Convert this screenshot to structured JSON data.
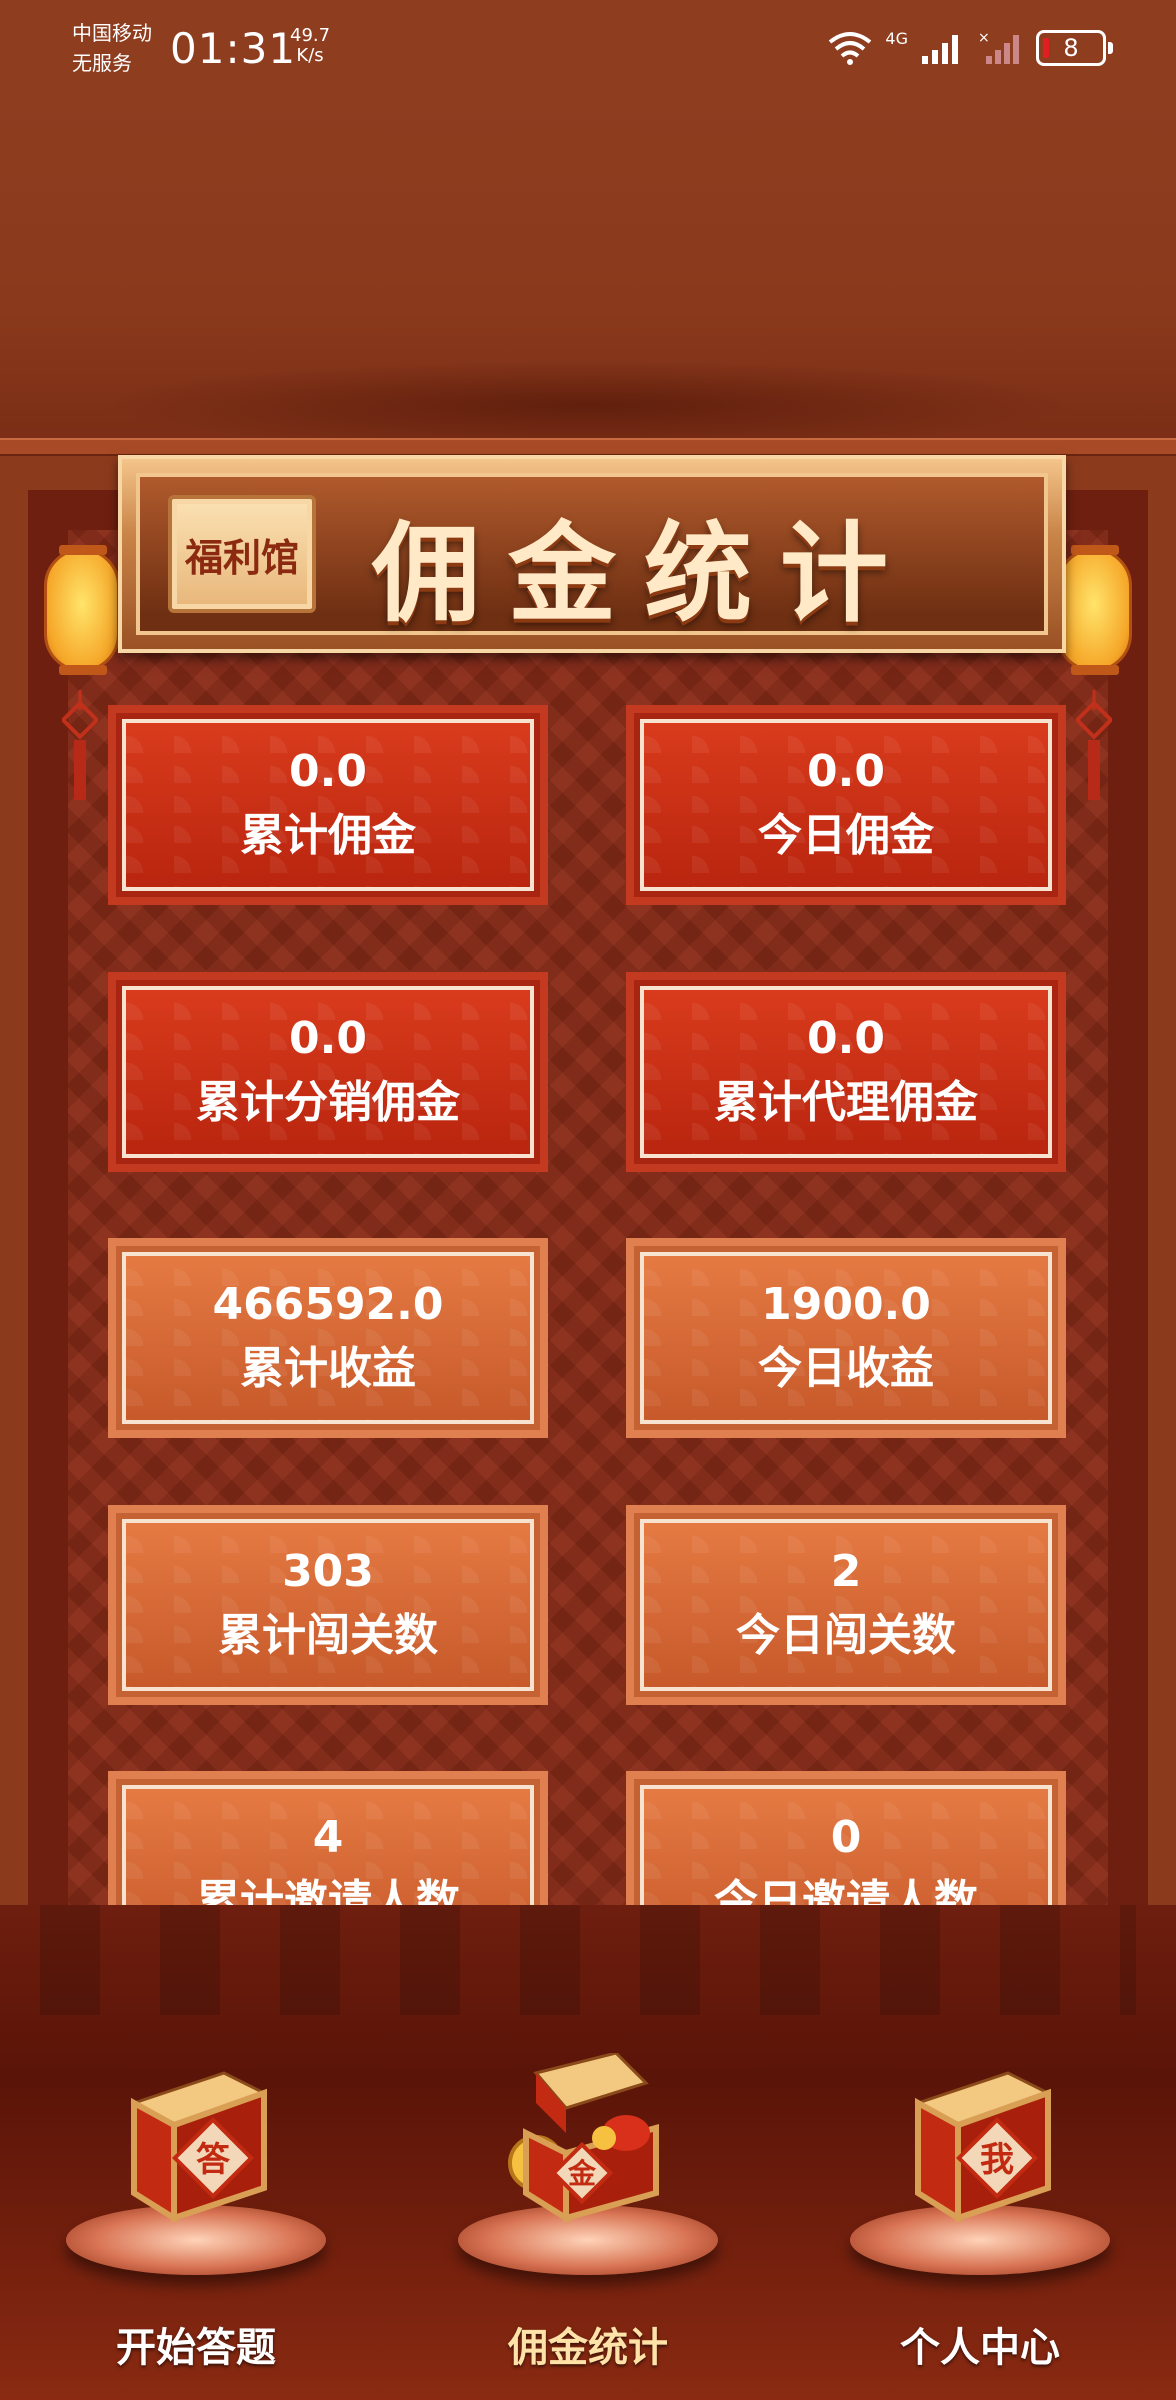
{
  "status_bar": {
    "carrier_line1": "中国移动",
    "carrier_line2": "无服务",
    "time": "01:31",
    "speed_value": "49.7",
    "speed_unit": "K/s",
    "network_label": "4G",
    "battery": "8"
  },
  "header": {
    "badge": "福利馆",
    "title": "佣金统计"
  },
  "stats": [
    {
      "value": "0.0",
      "label": "累计佣金",
      "style": "red"
    },
    {
      "value": "0.0",
      "label": "今日佣金",
      "style": "red"
    },
    {
      "value": "0.0",
      "label": "累计分销佣金",
      "style": "red"
    },
    {
      "value": "0.0",
      "label": "累计代理佣金",
      "style": "red"
    },
    {
      "value": "466592.0",
      "label": "累计收益",
      "style": "orange"
    },
    {
      "value": "1900.0",
      "label": "今日收益",
      "style": "orange"
    },
    {
      "value": "303",
      "label": "累计闯关数",
      "style": "orange"
    },
    {
      "value": "2",
      "label": "今日闯关数",
      "style": "orange"
    },
    {
      "value": "4",
      "label": "累计邀请人数",
      "style": "orange"
    },
    {
      "value": "0",
      "label": "今日邀请人数",
      "style": "orange"
    }
  ],
  "nav": [
    {
      "label": "开始答题",
      "icon": "answer-chest-icon",
      "glyph": "答",
      "active": false
    },
    {
      "label": "佣金统计",
      "icon": "gold-chest-icon",
      "glyph": "金",
      "active": true
    },
    {
      "label": "个人中心",
      "icon": "me-chest-icon",
      "glyph": "我",
      "active": false
    }
  ],
  "colors": {
    "background": "#8c3a1c",
    "card_red": "#d93b1c",
    "card_orange": "#e57a43",
    "title_text": "#ffe9c6"
  }
}
